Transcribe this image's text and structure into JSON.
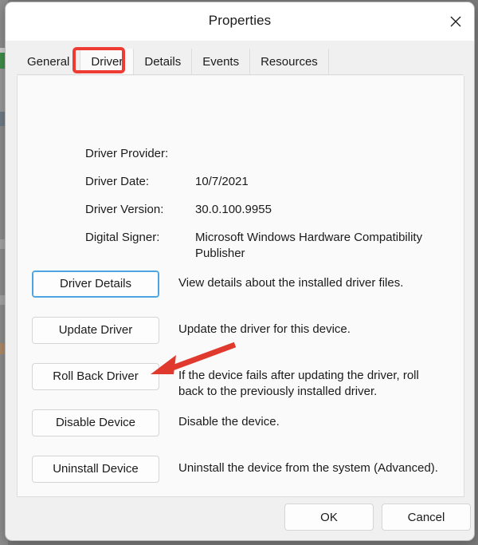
{
  "window": {
    "title": "Properties",
    "close_icon": "close-icon"
  },
  "tabs": [
    {
      "label": "General",
      "active": false
    },
    {
      "label": "Driver",
      "active": true
    },
    {
      "label": "Details",
      "active": false
    },
    {
      "label": "Events",
      "active": false
    },
    {
      "label": "Resources",
      "active": false
    }
  ],
  "driver_info": [
    {
      "label": "Driver Provider:",
      "value": ""
    },
    {
      "label": "Driver Date:",
      "value": "10/7/2021"
    },
    {
      "label": "Driver Version:",
      "value": "30.0.100.9955"
    },
    {
      "label": "Digital Signer:",
      "value": "Microsoft Windows Hardware Compatibility Publisher"
    }
  ],
  "actions": [
    {
      "button": "Driver Details",
      "description": "View details about the installed driver files.",
      "focused": true
    },
    {
      "button": "Update Driver",
      "description": "Update the driver for this device.",
      "focused": false
    },
    {
      "button": "Roll Back Driver",
      "description": "If the device fails after updating the driver, roll back to the previously installed driver.",
      "focused": false
    },
    {
      "button": "Disable Device",
      "description": "Disable the device.",
      "focused": false
    },
    {
      "button": "Uninstall Device",
      "description": "Uninstall the device from the system (Advanced).",
      "focused": false
    }
  ],
  "footer": {
    "ok_label": "OK",
    "cancel_label": "Cancel"
  },
  "annotations": {
    "highlight_color": "#ee3b33",
    "arrow_color": "#e03a2f",
    "focus_color": "#4ea3e0"
  }
}
